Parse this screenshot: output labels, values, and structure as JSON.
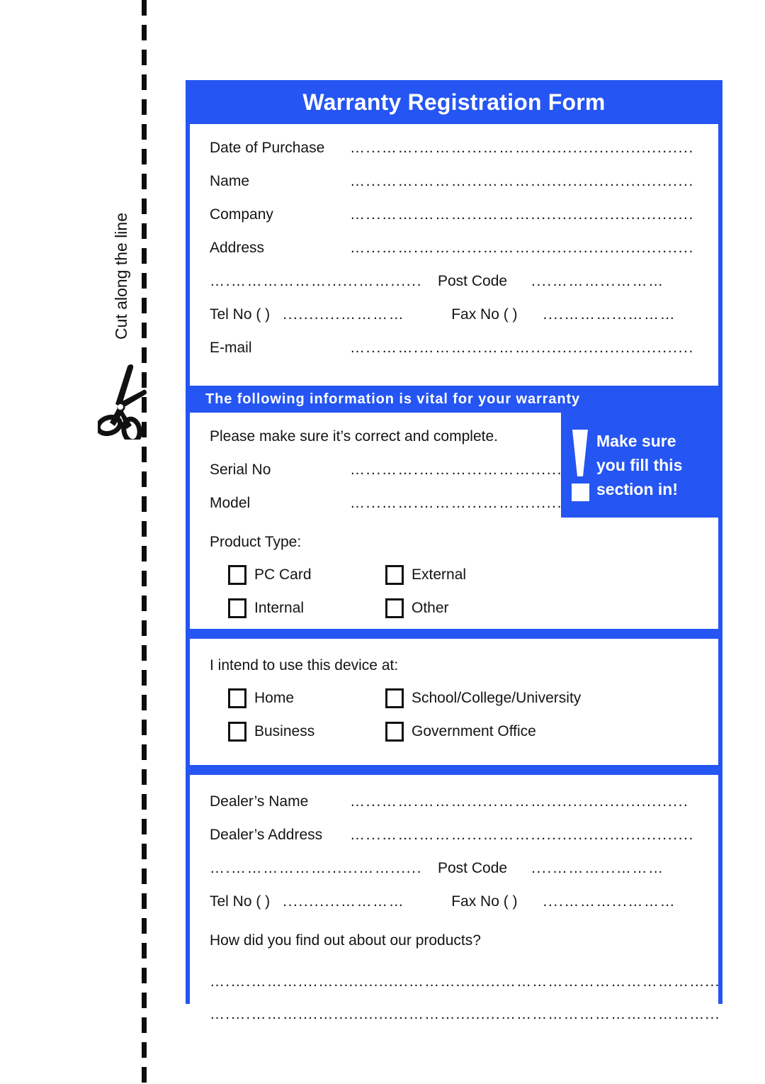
{
  "cut_strip": {
    "label": "Cut along the line",
    "scissors_icon": "scissors-icon"
  },
  "form": {
    "title": "Warranty Registration Form",
    "customer_section": {
      "rows": [
        {
          "label": "Date of Purchase",
          "dots": "…...…….………...………..............................."
        },
        {
          "label": "Name",
          "dots": "…...…….………...………..............................."
        },
        {
          "label": "Company",
          "dots": "…...…….………...………..............................."
        },
        {
          "label": "Address",
          "dots": "…...…….………...………..............................."
        }
      ],
      "postcode_row": {
        "dots_left": "….………………......……...........",
        "label": "Post Code",
        "dots_right": "....………...………"
      },
      "tel_row": {
        "tel_label": "Tel  No (    )",
        "tel_dots": "...........…………",
        "fax_label": "Fax No (    )",
        "fax_dots": "....………...………"
      },
      "email_row": {
        "label": "E-mail",
        "dots": "…...…….………...………..............................."
      }
    },
    "vital_banner": "The following information is vital for your warranty",
    "product_section": {
      "note": "Please make sure it’s correct and complete.",
      "rows": [
        {
          "label": "Serial No",
          "dots": "…...…….………...………..............................."
        },
        {
          "label": "Model",
          "dots": "…...…….………...………..............................."
        }
      ],
      "product_type_title": "Product Type:",
      "product_type_options": [
        "PC Card",
        "External",
        "Internal",
        "Other"
      ],
      "callout": {
        "line1": "Make  sure",
        "line2": "you fill this",
        "line3": "section in!",
        "icon": "exclamation-icon"
      }
    },
    "usage_section": {
      "title": "I intend to use this device at:",
      "options": [
        "Home",
        "School/College/University",
        "Business",
        "Government Office"
      ]
    },
    "dealer_section": {
      "rows": [
        {
          "label": "Dealer’s Name",
          "dots": "…...…….………......………..........................."
        },
        {
          "label": "Dealer’s Address",
          "dots": "…...…….………...………..............................."
        }
      ],
      "postcode_row": {
        "dots_left": "….………………......……...........",
        "label": "Post Code",
        "dots_right": "....………...………"
      },
      "tel_row": {
        "tel_label": "Tel  No (    )",
        "tel_dots": "...........…………",
        "fax_label": "Fax No (    )",
        "fax_dots": "....………...………"
      },
      "question": "How did you find out about our products?",
      "answer_line_1": "….….………....…...............……….........…………………………………....….……",
      "answer_line_2": "….….………....…...............……….........…………………………………....….……"
    }
  },
  "colors": {
    "brand_blue": "#2555f2",
    "ink": "#141414",
    "white": "#ffffff"
  }
}
